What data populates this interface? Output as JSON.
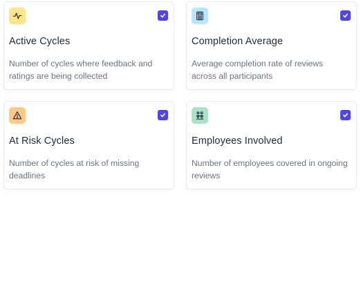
{
  "cards": [
    {
      "icon": "activity-icon",
      "icon_color": "#fde68a",
      "checked": true,
      "title": "Active Cycles",
      "description": "Number of cycles where feedback and ratings are being collected"
    },
    {
      "icon": "calculator-icon",
      "icon_color": "#bae6fd",
      "checked": true,
      "title": "Completion Average",
      "description": "Average completion rate of reviews across all participants"
    },
    {
      "icon": "warning-icon",
      "icon_color": "#fdc98a",
      "checked": true,
      "title": "At Risk Cycles",
      "description": "Number of cycles at risk of missing deadlines"
    },
    {
      "icon": "people-icon",
      "icon_color": "#a7e3c4",
      "checked": true,
      "title": "Employees Involved",
      "description": "Number of employees covered in ongoing reviews"
    }
  ],
  "colors": {
    "checkbox": "#4f46e5",
    "title_text": "#1f2937",
    "description_text": "#6b7280"
  }
}
